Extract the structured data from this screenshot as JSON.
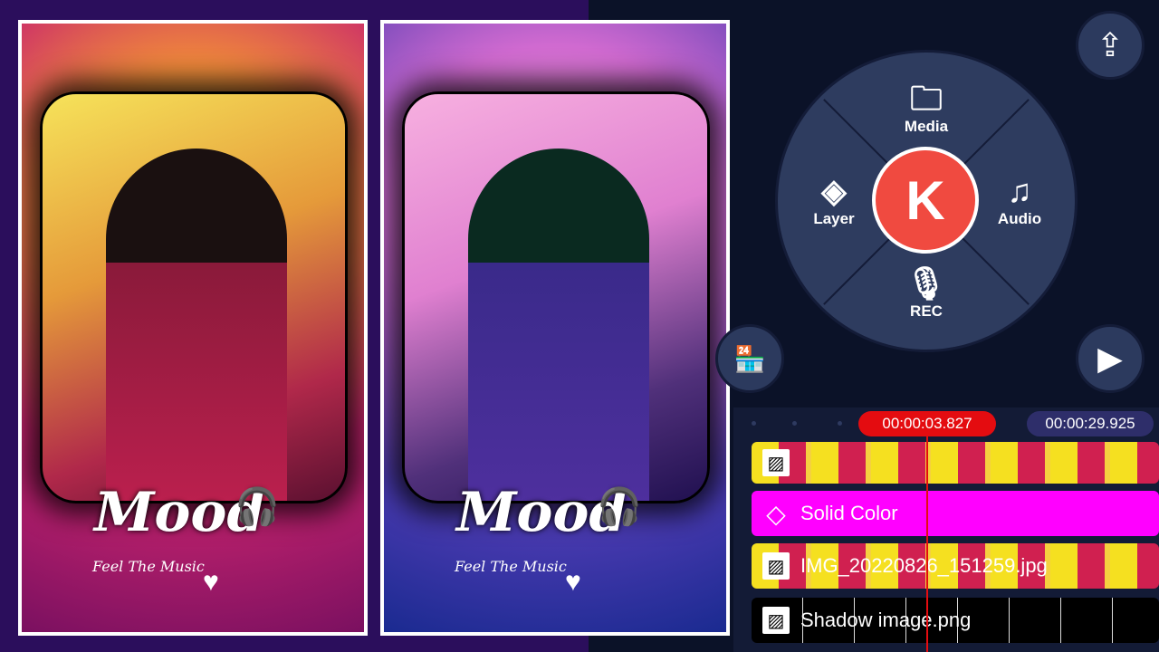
{
  "preview_before": {
    "title": "Mood",
    "subtitle": "Feel The Music"
  },
  "preview_after": {
    "title": "Mood",
    "subtitle": "Feel The Music"
  },
  "menu": {
    "center_label": "K",
    "media": "Media",
    "layer": "Layer",
    "audio": "Audio",
    "rec": "REC"
  },
  "icons": {
    "share": "share-icon",
    "play": "play-icon",
    "store": "store-icon"
  },
  "timeline": {
    "current_time": "00:00:03.827",
    "total_time": "00:00:29.925",
    "tracks": [
      {
        "label": "",
        "type": "image"
      },
      {
        "label": "Solid Color",
        "type": "solid-color"
      },
      {
        "label": "IMG_20220826_151259.jpg",
        "type": "image"
      },
      {
        "label": "Shadow image.png",
        "type": "image"
      }
    ]
  },
  "colors": {
    "accent": "#f04a40",
    "playhead": "#e40c10",
    "solid_color": "#ff00ff"
  }
}
